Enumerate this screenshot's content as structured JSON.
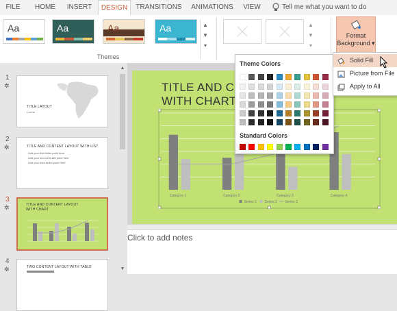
{
  "ribbon_tabs": [
    "FILE",
    "HOME",
    "INSERT",
    "DESIGN",
    "TRANSITIONS",
    "ANIMATIONS",
    "VIEW"
  ],
  "tell_me": "Tell me what you want to do",
  "themes_group_label": "Themes",
  "theme_sample_text": "Aa",
  "format_background": {
    "line1": "Format",
    "line2": "Background",
    "arrow": "▾"
  },
  "bg_menu": {
    "items": [
      "Solid Fill",
      "Picture from File",
      "Apply to All"
    ]
  },
  "color_popup": {
    "theme_colors_label": "Theme Colors",
    "standard_colors_label": "Standard Colors",
    "theme_top_row": [
      "#ffffff",
      "#595959",
      "#444444",
      "#222222",
      "#2b8cc4",
      "#f0a830",
      "#3a9e8e",
      "#e2c33a",
      "#d0532f",
      "#9a2c4a"
    ],
    "standard_row": [
      "#c00000",
      "#ff0000",
      "#ffc000",
      "#ffff00",
      "#92d050",
      "#00b050",
      "#00b0f0",
      "#0070c0",
      "#002060",
      "#7030a0"
    ]
  },
  "slides": [
    {
      "number": "1",
      "title": "TITLE LAYOUT",
      "subtitle": "Lorem"
    },
    {
      "number": "2",
      "title": "TITLE AND CONTENT LAYOUT WITH LIST",
      "bullets": [
        "Add your first bullet point here",
        "Add your second bullet point here",
        "Add your third bullet point here"
      ]
    },
    {
      "number": "3",
      "title_line1": "TITLE AND CONTENT LAYOUT",
      "title_line2": "WITH CHART"
    },
    {
      "number": "4",
      "title": "TWO CONTENT LAYOUT WITH TABLE"
    }
  ],
  "slide": {
    "title_line1": "TITLE AND CO",
    "title_line2": "WITH CHART"
  },
  "notes_placeholder": "Click to add notes",
  "chart_data": {
    "type": "bar",
    "categories": [
      "Category 1",
      "Category 2",
      "Category 3",
      "Category 4"
    ],
    "series": [
      {
        "name": "Series 1",
        "values": [
          4.3,
          2.5,
          3.5,
          4.5
        ]
      },
      {
        "name": "Series 2",
        "values": [
          2.4,
          4.4,
          1.8,
          2.8
        ]
      },
      {
        "name": "Series 3",
        "values": [
          2.0,
          2.0,
          3.0,
          5.0
        ]
      }
    ],
    "ylim": [
      0,
      6
    ],
    "colors": [
      "#7f7f7f",
      "#bfbfbf",
      "#a6a6a6"
    ]
  }
}
